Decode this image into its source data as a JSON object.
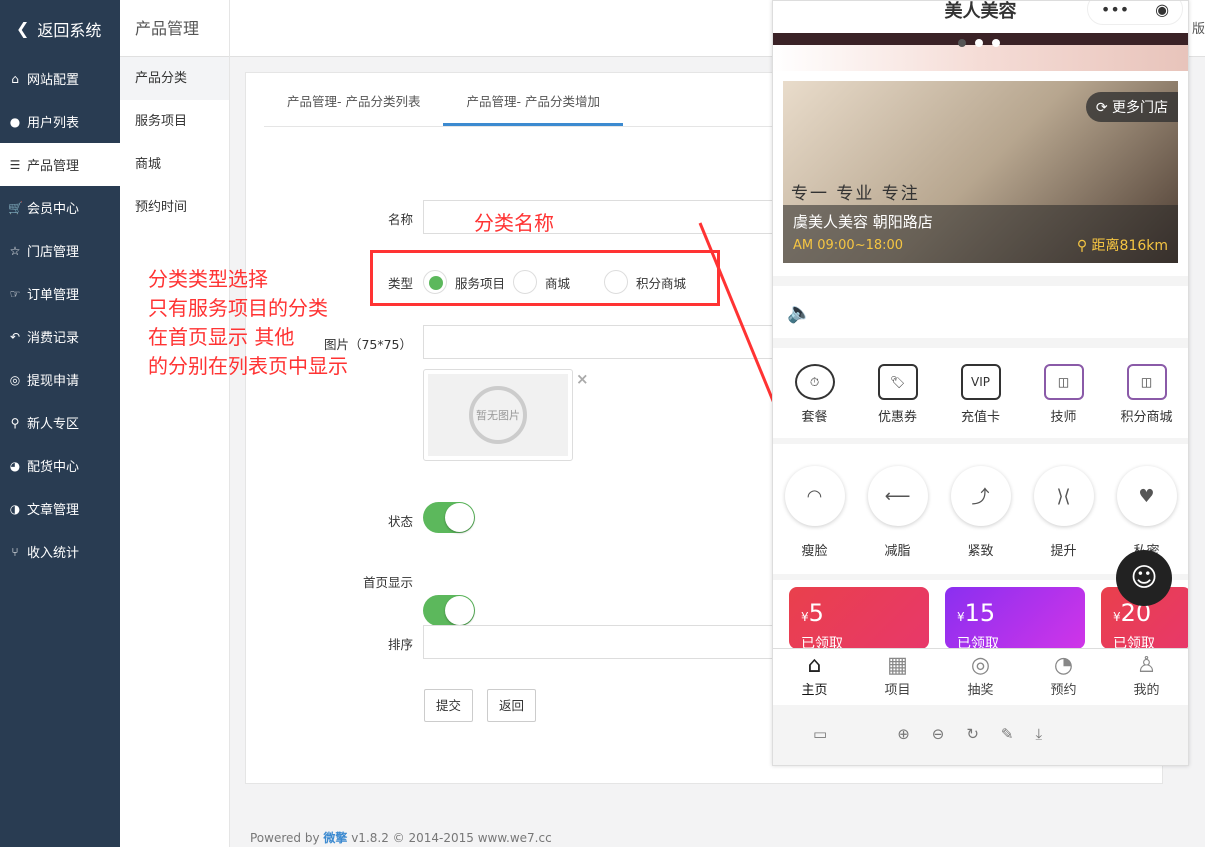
{
  "sidebar": {
    "back": "返回系统",
    "items": [
      {
        "label": "网站配置",
        "icon": "home-icon",
        "glyph": "⌂"
      },
      {
        "label": "用户列表",
        "icon": "user-icon",
        "glyph": "●"
      },
      {
        "label": "产品管理",
        "icon": "server-icon",
        "glyph": "☰"
      },
      {
        "label": "会员中心",
        "icon": "cart-icon",
        "glyph": "🛒"
      },
      {
        "label": "门店管理",
        "icon": "star-icon",
        "glyph": "☆"
      },
      {
        "label": "订单管理",
        "icon": "hand-icon",
        "glyph": "☞"
      },
      {
        "label": "消费记录",
        "icon": "reply-icon",
        "glyph": "↶"
      },
      {
        "label": "提现申请",
        "icon": "wechat-icon",
        "glyph": "◎"
      },
      {
        "label": "新人专区",
        "icon": "map-marker-icon",
        "glyph": "⚲"
      },
      {
        "label": "配货中心",
        "icon": "pie-chart-icon",
        "glyph": "◕"
      },
      {
        "label": "文章管理",
        "icon": "adjust-icon",
        "glyph": "◑"
      },
      {
        "label": "收入统计",
        "icon": "branch-icon",
        "glyph": "⑂"
      }
    ]
  },
  "submenu": {
    "title": "产品管理",
    "items": [
      "产品分类",
      "服务项目",
      "商城",
      "预约时间"
    ]
  },
  "tabs": [
    "产品管理- 产品分类列表",
    "产品管理- 产品分类增加"
  ],
  "form": {
    "name_label": "名称",
    "type_label": "类型",
    "type_options": [
      "服务项目",
      "商城",
      "积分商城"
    ],
    "selected": "服务项目",
    "image_label": "图片（75*75）",
    "no_image": "暂无图片",
    "remove": "×",
    "status_label": "状态",
    "home_label": "首页显示",
    "sort_label": "排序",
    "submit": "提交",
    "back": "返回",
    "status_on": true,
    "home_on": true
  },
  "annotations": {
    "name_note": "分类名称",
    "type_note": [
      "分类类型选择",
      "只有服务项目的分类",
      "在首页显示 其他",
      "的分别在列表页中显示"
    ]
  },
  "topbar_partial": "版",
  "footer": {
    "prefix": "Powered by ",
    "brand": "微擎",
    "rest": " v1.8.2 © 2014-2015 www.we7.cc"
  },
  "phone": {
    "title": "美人美容",
    "store_more": "更多门店",
    "store_name": "虞美人美容 朝阳路店",
    "hours": "AM 09:00~18:00",
    "distance": "距离816km",
    "banner_text": "专一 专业 专注",
    "grid1": [
      "套餐",
      "优惠券",
      "充值卡",
      "技师",
      "积分商城"
    ],
    "grid2": [
      "瘦脸",
      "减脂",
      "紧致",
      "提升",
      "私密"
    ],
    "coupons": [
      {
        "amount": "5",
        "status": "已领取",
        "color": "#e8384f"
      },
      {
        "amount": "15",
        "status": "已领取",
        "color": "#a033f0"
      },
      {
        "amount": "20",
        "status": "已领取",
        "color": "#e8384f"
      }
    ],
    "currency": "¥",
    "tabbar": [
      "主页",
      "项目",
      "抽奖",
      "预约",
      "我的"
    ],
    "vip": "VIP"
  }
}
